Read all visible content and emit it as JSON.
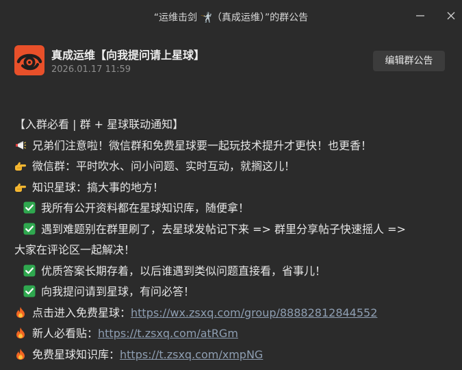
{
  "window": {
    "title": "“运维击剑 🤺（真成运维）”的群公告"
  },
  "header": {
    "group_name": "真成运维【向我提问请上星球】",
    "timestamp": "2026.01.17 11:59",
    "edit_label": "编辑群公告"
  },
  "announcement": {
    "heading": "【入群必看 | 群 + 星球联动通知】",
    "intro": "兄弟们注意啦！微信群和免费星球要一起玩技术提升才更快！也更香！",
    "wechat_group": "微信群：平时吹水、问小问题、实时互动，就搁这儿！",
    "planet": "知识星球：搞大事的地方！",
    "points": [
      "我所有公开资料都在星球知识库，随便拿！",
      "遇到难题别在群里刷了，去星球发帖记下来 => 群里分享帖子快速摇人 =>",
      "优质答案长期存着，以后谁遇到类似问题直接看，省事儿！",
      "向我提问请到星球，有问必答！"
    ],
    "point2_continued": "大家在评论区一起解决！",
    "links": [
      {
        "label": "点击进入免费星球：",
        "url": "https://wx.zsxq.com/group/88882812844552"
      },
      {
        "label": "新人必看贴：",
        "url": "https://t.zsxq.com/atRGm"
      },
      {
        "label": "免费星球知识库：",
        "url": "https://t.zsxq.com/xmpNG"
      }
    ]
  },
  "colors": {
    "background": "#2b2b2b",
    "link": "#8f9fb3",
    "check_green": "#2fa84f",
    "avatar_bg": "#e8502a"
  }
}
